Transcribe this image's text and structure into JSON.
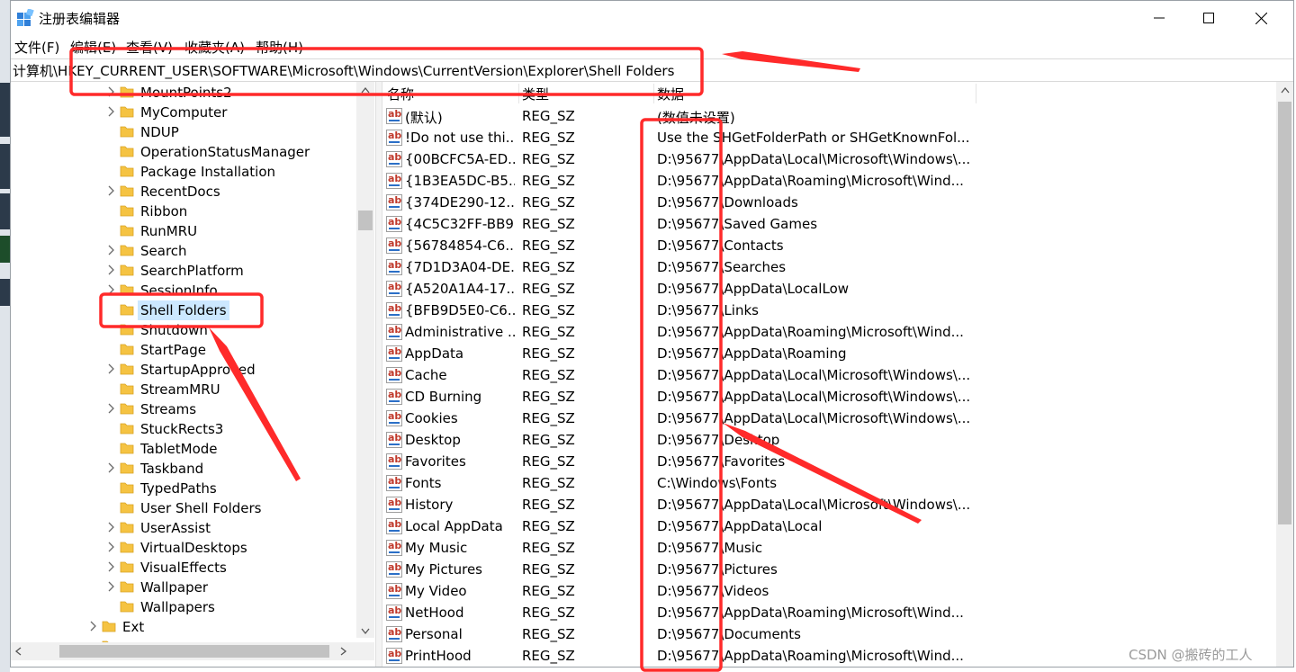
{
  "window": {
    "title": "注册表编辑器"
  },
  "menu": [
    "文件(F)",
    "编辑(E)",
    "查看(V)",
    "收藏夹(A)",
    "帮助(H)"
  ],
  "address": "计算机\\HKEY_CURRENT_USER\\SOFTWARE\\Microsoft\\Windows\\CurrentVersion\\Explorer\\Shell Folders",
  "tree": {
    "items": [
      {
        "label": "MountPoints2",
        "expander": true
      },
      {
        "label": "MyComputer",
        "expander": true
      },
      {
        "label": "NDUP",
        "expander": false
      },
      {
        "label": "OperationStatusManager",
        "expander": false
      },
      {
        "label": "Package Installation",
        "expander": false
      },
      {
        "label": "RecentDocs",
        "expander": true
      },
      {
        "label": "Ribbon",
        "expander": false
      },
      {
        "label": "RunMRU",
        "expander": false
      },
      {
        "label": "Search",
        "expander": true
      },
      {
        "label": "SearchPlatform",
        "expander": true
      },
      {
        "label": "SessionInfo",
        "expander": true
      },
      {
        "label": "Shell Folders",
        "expander": false,
        "selected": true
      },
      {
        "label": "Shutdown",
        "expander": false
      },
      {
        "label": "StartPage",
        "expander": false
      },
      {
        "label": "StartupApproved",
        "expander": true
      },
      {
        "label": "StreamMRU",
        "expander": false
      },
      {
        "label": "Streams",
        "expander": true
      },
      {
        "label": "StuckRects3",
        "expander": false
      },
      {
        "label": "TabletMode",
        "expander": false
      },
      {
        "label": "Taskband",
        "expander": true
      },
      {
        "label": "TypedPaths",
        "expander": false
      },
      {
        "label": "User Shell Folders",
        "expander": false
      },
      {
        "label": "UserAssist",
        "expander": true
      },
      {
        "label": "VirtualDesktops",
        "expander": true
      },
      {
        "label": "VisualEffects",
        "expander": true
      },
      {
        "label": "Wallpaper",
        "expander": true
      },
      {
        "label": "Wallpapers",
        "expander": false
      }
    ],
    "parent_item": {
      "label": "Ext",
      "expander": true
    }
  },
  "columns": {
    "name": "名称",
    "type": "类型",
    "data": "数据"
  },
  "rows": [
    {
      "name": "(默认)",
      "type": "REG_SZ",
      "data": "(数值未设置)"
    },
    {
      "name": "!Do not use thi...",
      "type": "REG_SZ",
      "data": "Use the SHGetFolderPath or SHGetKnownFol..."
    },
    {
      "name": "{00BCFC5A-ED...",
      "type": "REG_SZ",
      "data": "D:\\95677\\AppData\\Local\\Microsoft\\Windows\\..."
    },
    {
      "name": "{1B3EA5DC-B5...",
      "type": "REG_SZ",
      "data": "D:\\95677\\AppData\\Roaming\\Microsoft\\Wind..."
    },
    {
      "name": "{374DE290-12...",
      "type": "REG_SZ",
      "data": "D:\\95677\\Downloads"
    },
    {
      "name": "{4C5C32FF-BB9...",
      "type": "REG_SZ",
      "data": "D:\\95677\\Saved Games"
    },
    {
      "name": "{56784854-C6...",
      "type": "REG_SZ",
      "data": "D:\\95677\\Contacts"
    },
    {
      "name": "{7D1D3A04-DE...",
      "type": "REG_SZ",
      "data": "D:\\95677\\Searches"
    },
    {
      "name": "{A520A1A4-17...",
      "type": "REG_SZ",
      "data": "D:\\95677\\AppData\\LocalLow"
    },
    {
      "name": "{BFB9D5E0-C6...",
      "type": "REG_SZ",
      "data": "D:\\95677\\Links"
    },
    {
      "name": "Administrative ...",
      "type": "REG_SZ",
      "data": "D:\\95677\\AppData\\Roaming\\Microsoft\\Wind..."
    },
    {
      "name": "AppData",
      "type": "REG_SZ",
      "data": "D:\\95677\\AppData\\Roaming"
    },
    {
      "name": "Cache",
      "type": "REG_SZ",
      "data": "D:\\95677\\AppData\\Local\\Microsoft\\Windows\\..."
    },
    {
      "name": "CD Burning",
      "type": "REG_SZ",
      "data": "D:\\95677\\AppData\\Local\\Microsoft\\Windows\\..."
    },
    {
      "name": "Cookies",
      "type": "REG_SZ",
      "data": "D:\\95677\\AppData\\Local\\Microsoft\\Windows\\..."
    },
    {
      "name": "Desktop",
      "type": "REG_SZ",
      "data": "D:\\95677\\Desktop"
    },
    {
      "name": "Favorites",
      "type": "REG_SZ",
      "data": "D:\\95677\\Favorites"
    },
    {
      "name": "Fonts",
      "type": "REG_SZ",
      "data": "C:\\Windows\\Fonts"
    },
    {
      "name": "History",
      "type": "REG_SZ",
      "data": "D:\\95677\\AppData\\Local\\Microsoft\\Windows\\..."
    },
    {
      "name": "Local AppData",
      "type": "REG_SZ",
      "data": "D:\\95677\\AppData\\Local"
    },
    {
      "name": "My Music",
      "type": "REG_SZ",
      "data": "D:\\95677\\Music"
    },
    {
      "name": "My Pictures",
      "type": "REG_SZ",
      "data": "D:\\95677\\Pictures"
    },
    {
      "name": "My Video",
      "type": "REG_SZ",
      "data": "D:\\95677\\Videos"
    },
    {
      "name": "NetHood",
      "type": "REG_SZ",
      "data": "D:\\95677\\AppData\\Roaming\\Microsoft\\Wind..."
    },
    {
      "name": "Personal",
      "type": "REG_SZ",
      "data": "D:\\95677\\Documents"
    },
    {
      "name": "PrintHood",
      "type": "REG_SZ",
      "data": "D:\\95677\\AppData\\Roaming\\Microsoft\\Wind..."
    }
  ],
  "watermark": "CSDN @搬砖的工人",
  "colors": {
    "annotation": "#ff2a2a",
    "selection": "#cce8ff",
    "folder": "#f5c342"
  }
}
